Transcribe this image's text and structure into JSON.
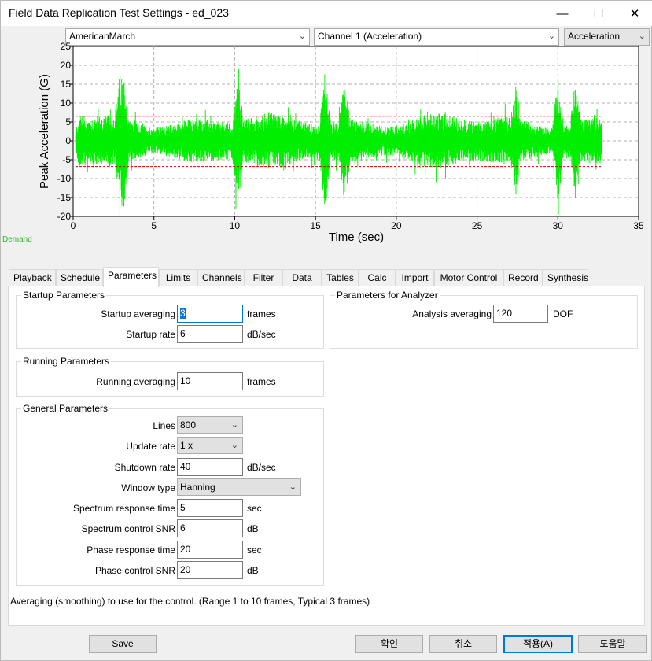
{
  "window": {
    "title": "Field Data Replication Test Settings - ed_023",
    "min_glyph": "—",
    "max_glyph": "☐",
    "close_glyph": "✕"
  },
  "selectors": {
    "profile": "AmericanMarch",
    "channel": "Channel 1 (Acceleration)",
    "measure": "Acceleration"
  },
  "chart_data": {
    "type": "line",
    "xlabel": "Time (sec)",
    "ylabel": "Peak Acceleration (G)",
    "xlim": [
      0,
      35
    ],
    "ylim": [
      -20,
      25
    ],
    "x_ticks": [
      "0",
      "5",
      "10",
      "15",
      "20",
      "25",
      "30",
      "35"
    ],
    "y_ticks": [
      "25",
      "20",
      "15",
      "10",
      "5",
      "0",
      "-5",
      "-10",
      "-15",
      "-20"
    ],
    "grid": true,
    "series_color": "#00ee00",
    "abort_line_color": "#cc0000",
    "abort_limits": [
      6.5,
      -6.8
    ],
    "data_end_sec": 32.7,
    "envelope_peaks": [
      {
        "x": 0.5,
        "y": 8
      },
      {
        "x": 2.9,
        "y": 17
      },
      {
        "x": 3.1,
        "y": -19
      },
      {
        "x": 10.2,
        "y": -17
      },
      {
        "x": 15.6,
        "y": -19
      },
      {
        "x": 16.8,
        "y": 17
      },
      {
        "x": 27.4,
        "y": -15
      },
      {
        "x": 30.0,
        "y": 18
      },
      {
        "x": 31.1,
        "y": 17
      }
    ]
  },
  "legend": {
    "demand": "Demand"
  },
  "tabs": [
    "Playback",
    "Schedule",
    "Parameters",
    "Limits",
    "Channels",
    "Filter",
    "Data",
    "Tables",
    "Calc",
    "Import",
    "Motor Control",
    "Record",
    "Synthesis"
  ],
  "active_tab": "Parameters",
  "startup": {
    "title": "Startup Parameters",
    "averaging_label": "Startup averaging",
    "averaging_value": "3",
    "averaging_unit": "frames",
    "rate_label": "Startup rate",
    "rate_value": "6",
    "rate_unit": "dB/sec"
  },
  "analyzer": {
    "title": "Parameters for Analyzer",
    "averaging_label": "Analysis averaging",
    "averaging_value": "120",
    "averaging_unit": "DOF"
  },
  "running": {
    "title": "Running Parameters",
    "averaging_label": "Running averaging",
    "averaging_value": "10",
    "averaging_unit": "frames"
  },
  "general": {
    "title": "General Parameters",
    "lines_label": "Lines",
    "lines_value": "800",
    "update_label": "Update rate",
    "update_value": "1 x",
    "shutdown_label": "Shutdown rate",
    "shutdown_value": "40",
    "shutdown_unit": "dB/sec",
    "window_label": "Window type",
    "window_value": "Hanning",
    "spec_resp_label": "Spectrum response time",
    "spec_resp_value": "5",
    "spec_resp_unit": "sec",
    "spec_snr_label": "Spectrum control SNR",
    "spec_snr_value": "6",
    "spec_snr_unit": "dB",
    "phase_resp_label": "Phase response time",
    "phase_resp_value": "20",
    "phase_resp_unit": "sec",
    "phase_snr_label": "Phase control SNR",
    "phase_snr_value": "20",
    "phase_snr_unit": "dB"
  },
  "hint": "Averaging (smoothing) to use for the control.  (Range 1 to 10 frames, Typical 3 frames)",
  "buttons": {
    "save": "Save",
    "ok": "확인",
    "cancel": "취소",
    "apply_text": "적용(",
    "apply_key": "A",
    "apply_close": ")",
    "help": "도움말"
  }
}
